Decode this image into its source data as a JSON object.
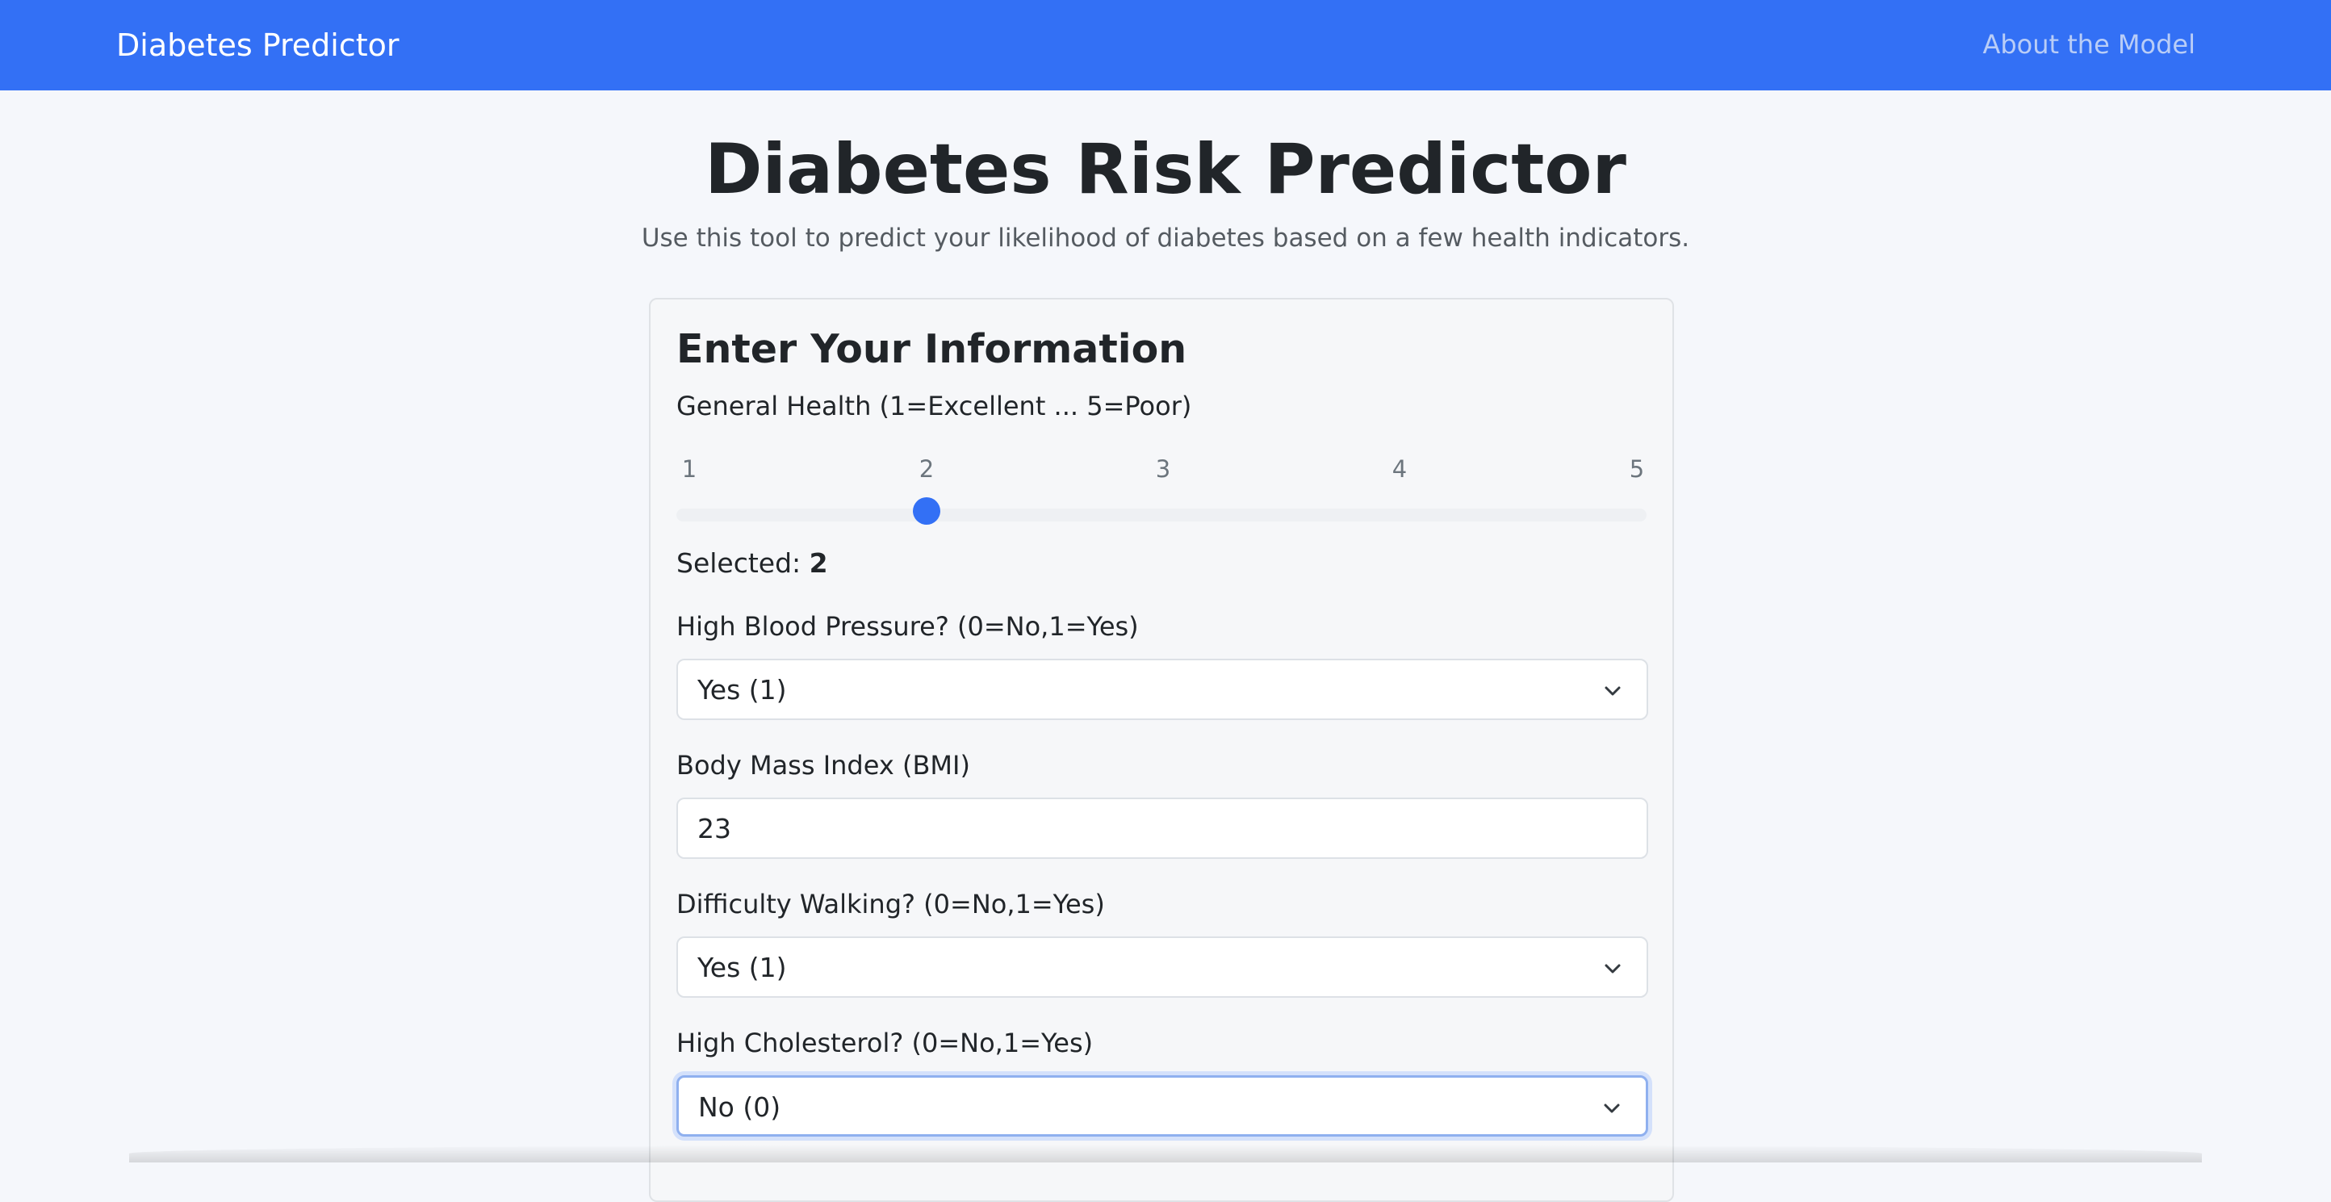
{
  "navbar": {
    "brand": "Diabetes Predictor",
    "about_link": "About the Model",
    "background_color": "#3370f5"
  },
  "header": {
    "title": "Diabetes Risk Predictor",
    "subtitle": "Use this tool to predict your likelihood of diabetes based on a few health indicators."
  },
  "form": {
    "title": "Enter Your Information",
    "general_health": {
      "label": "General Health (1=Excellent ... 5=Poor)",
      "ticks": [
        "1",
        "2",
        "3",
        "4",
        "5"
      ],
      "min": 1,
      "max": 5,
      "value": 2,
      "selected_prefix": "Selected: ",
      "selected_value": "2"
    },
    "high_bp": {
      "label": "High Blood Pressure? (0=No,1=Yes)",
      "value": "Yes (1)"
    },
    "bmi": {
      "label": "Body Mass Index (BMI)",
      "value": "23"
    },
    "diff_walk": {
      "label": "Difficulty Walking? (0=No,1=Yes)",
      "value": "Yes (1)"
    },
    "high_chol": {
      "label": "High Cholesterol? (0=No,1=Yes)",
      "value": "No (0)"
    }
  },
  "icons": {
    "dropdown": "chevron-down-icon"
  },
  "colors": {
    "accent": "#3370f5",
    "page_background": "#f5f7fb"
  }
}
